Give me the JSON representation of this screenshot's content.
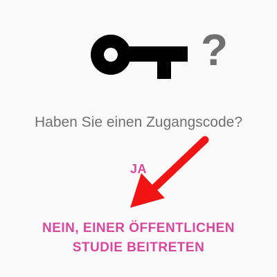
{
  "hero": {
    "icon": "key-icon",
    "symbol": "?"
  },
  "prompt": {
    "text": "Haben Sie einen Zugangscode?"
  },
  "actions": {
    "yes_label": "JA",
    "no_label_line1": "NEIN, EINER ÖFFENTLICHEN",
    "no_label_line2": "STUDIE BEITRETEN"
  },
  "annotation": {
    "icon": "arrow-icon",
    "color": "#f01414"
  },
  "colors": {
    "accent": "#d9469e",
    "text_muted": "#707070",
    "icon": "#000000",
    "background": "#fafafa"
  }
}
